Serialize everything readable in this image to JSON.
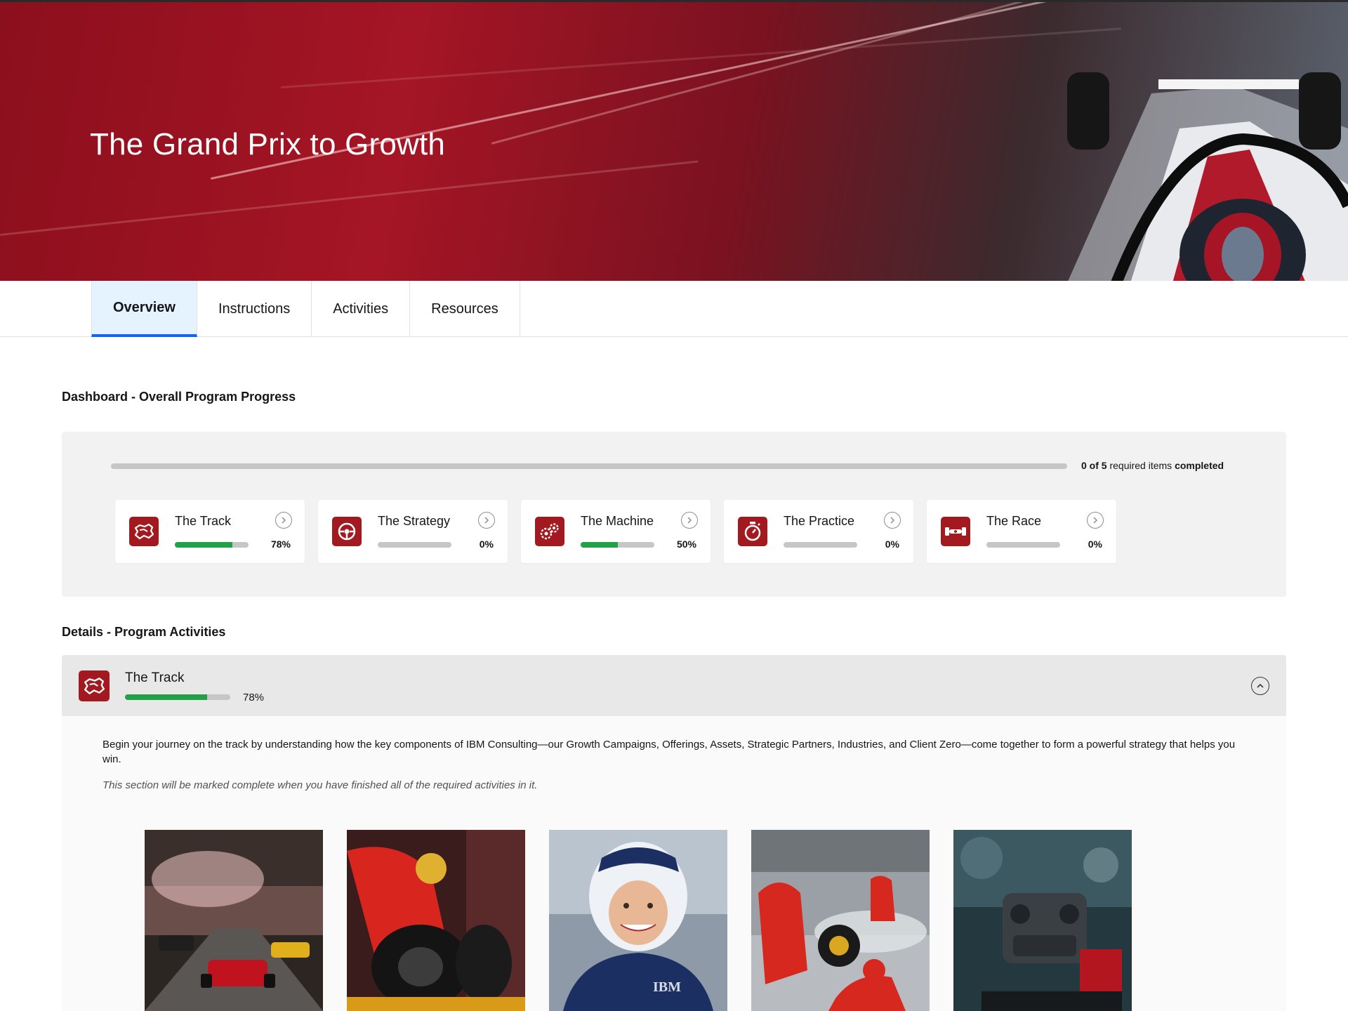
{
  "hero": {
    "title": "The Grand Prix to Growth"
  },
  "tabs": [
    {
      "label": "Overview",
      "active": true
    },
    {
      "label": "Instructions",
      "active": false
    },
    {
      "label": "Activities",
      "active": false
    },
    {
      "label": "Resources",
      "active": false
    }
  ],
  "dashboard": {
    "title": "Dashboard - Overall Program Progress",
    "overall": {
      "completed": 0,
      "total": 5,
      "text_count": "0 of 5",
      "text_mid": " required items ",
      "text_end": "completed",
      "fraction": 0
    },
    "cards": [
      {
        "name": "The Track",
        "percent_label": "78%",
        "percent": 78,
        "icon": "track-map-icon"
      },
      {
        "name": "The Strategy",
        "percent_label": "0%",
        "percent": 0,
        "icon": "steering-wheel-icon"
      },
      {
        "name": "The Machine",
        "percent_label": "50%",
        "percent": 50,
        "icon": "gears-icon"
      },
      {
        "name": "The Practice",
        "percent_label": "0%",
        "percent": 0,
        "icon": "stopwatch-icon"
      },
      {
        "name": "The Race",
        "percent_label": "0%",
        "percent": 0,
        "icon": "race-car-icon"
      }
    ]
  },
  "details": {
    "title": "Details - Program Activities",
    "section": {
      "name": "The Track",
      "percent_label": "78%",
      "percent": 78,
      "description": "Begin your journey on the track by understanding how the key components of IBM Consulting—our Growth Campaigns, Offerings, Assets, Strategic Partners, Industries, and Client Zero—come together to form a powerful strategy that helps you win.",
      "note": "This section will be marked complete when you have finished all of the required activities in it."
    },
    "tiles": [
      {
        "icon": "race-cars-on-track-image"
      },
      {
        "icon": "pit-crew-tire-image"
      },
      {
        "icon": "driver-helmet-image",
        "logo_text": "IBM"
      },
      {
        "icon": "pit-stop-image"
      },
      {
        "icon": "engine-image"
      }
    ]
  },
  "colors": {
    "accent": "#a2191f",
    "progress": "#24a148",
    "tab_active": "#0f62fe",
    "hero": "#a51525"
  }
}
